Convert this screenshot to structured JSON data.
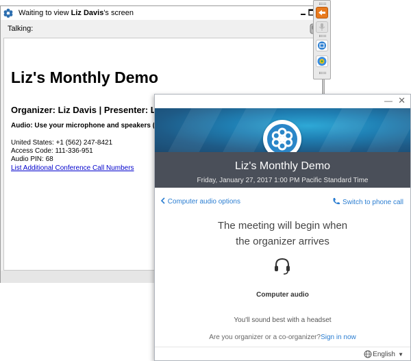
{
  "viewer": {
    "title_prefix": "Waiting to view ",
    "title_name": "Liz Davis",
    "title_suffix": "'s screen",
    "talking_label": "Talking:",
    "heading": "Liz's Monthly Demo",
    "organizer_line": "Organizer: Liz Davis  |  Presenter: L",
    "audio_line": "Audio: Use your microphone and speakers (",
    "dial_in": [
      "United States: +1 (562) 247-8421",
      "Access Code: 111-336-951",
      "Audio PIN: 68"
    ],
    "more_numbers_link": "List Additional Conference Call Numbers"
  },
  "dialog": {
    "meeting_title": "Liz's Monthly Demo",
    "date_line": "Friday, January 27, 2017    1:00 PM Pacific Standard Time",
    "computer_audio_options": "Computer audio options",
    "switch_to_phone": "Switch to phone call",
    "wait_line_1": "The meeting will begin when",
    "wait_line_2": "the organizer arrives",
    "computer_audio": "Computer audio",
    "headset_hint": "You'll sound best with a headset",
    "organizer_question": "Are you organizer or a co-organizer?",
    "sign_in": "Sign in now",
    "language": "English"
  },
  "colors": {
    "accent_blue": "#2a7dd1",
    "title_band": "#4a4f59",
    "banner_blue": "#1f7fb3",
    "toolbar_orange": "#e87a1e"
  }
}
